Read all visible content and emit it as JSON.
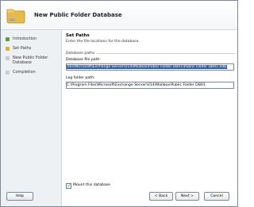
{
  "window": {
    "title": "New Public Folder Database"
  },
  "sidebar": {
    "steps": [
      {
        "label": "Introduction",
        "color": "#5aa02c"
      },
      {
        "label": "Set Paths",
        "color": "#d8b428"
      },
      {
        "label": "New Public Folder",
        "label2": "Database",
        "color": "#c8ccd0"
      },
      {
        "label": "Completion",
        "color": "#c8ccd0"
      }
    ]
  },
  "main": {
    "section_title": "Set Paths",
    "section_description": "Enter the file locations for the database.",
    "group_label": "Database paths",
    "db_path_label": "Database file path:",
    "db_path_value": "iles\\Microsoft\\Exchange Server\\V14\\Mailbox\\Public Folder DB01\\Public Folder DB01.edb",
    "log_folder_label": "Log folder path:",
    "log_folder_value": "C:\\Program Files\\Microsoft\\Exchange Server\\V14\\Mailbox\\Public Folder DB01",
    "mount_label": "Mount this database",
    "mount_checked": true
  },
  "buttons": {
    "help": "Help",
    "back": "< Back",
    "next": "Next >",
    "cancel": "Cancel"
  }
}
